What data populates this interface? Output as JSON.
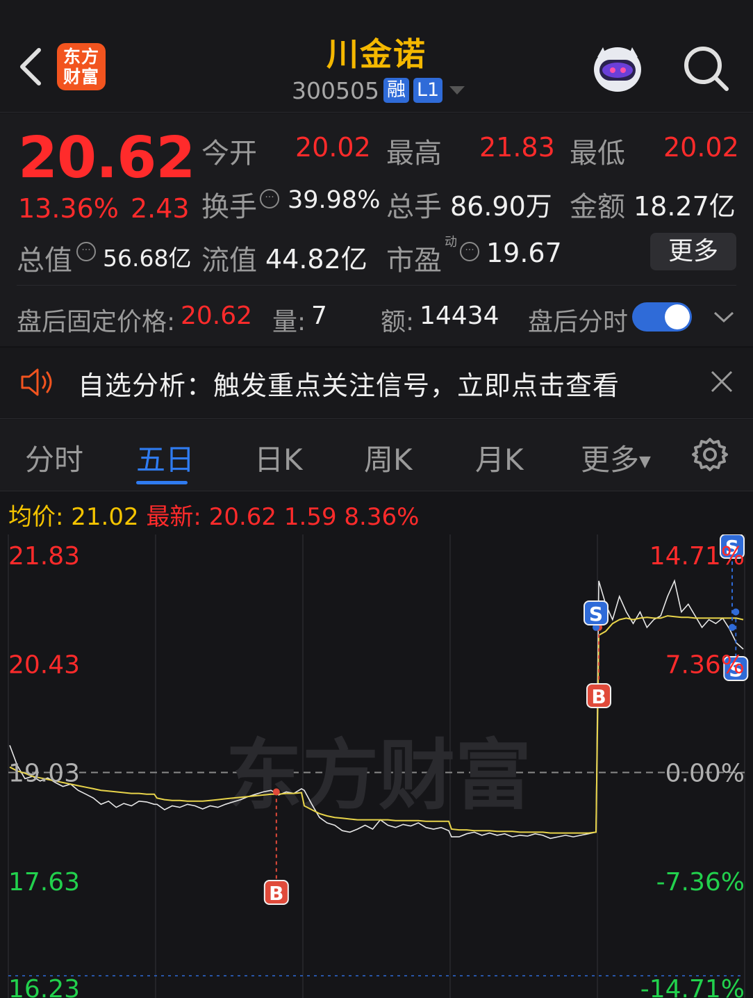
{
  "header": {
    "app_logo_text": [
      "东方",
      "财富"
    ],
    "stock_name": "川金诺",
    "stock_code": "300505",
    "tag_margin": "融",
    "tag_level": "L1"
  },
  "quote": {
    "price": "20.62",
    "change_pct": "13.36%",
    "change_amt": "2.43",
    "open_label": "今开",
    "open_value": "20.02",
    "high_label": "最高",
    "high_value": "21.83",
    "low_label": "最低",
    "low_value": "20.02",
    "turnover_label": "换手",
    "turnover_value": "39.98%",
    "volume_label": "总手",
    "volume_value": "86.90万",
    "amount_label": "金额",
    "amount_value": "18.27亿",
    "mktcap_label": "总值",
    "mktcap_value": "56.68亿",
    "float_label": "流值",
    "float_value": "44.82亿",
    "pe_label": "市盈",
    "pe_superscript": "动",
    "pe_value": "19.67",
    "more_button": "更多"
  },
  "after_hours": {
    "price_label": "盘后固定价格:",
    "price_value": "20.62",
    "qty_label": "量:",
    "qty_value": "7",
    "amount_label": "额:",
    "amount_value": "14434",
    "toggle_label": "盘后分时",
    "toggle_on": true
  },
  "alert": {
    "text": "自选分析：触发重点关注信号，立即点击查看"
  },
  "tabs": [
    "分时",
    "五日",
    "日K",
    "周K",
    "月K",
    "更多"
  ],
  "active_tab": 1,
  "chart_info": {
    "avg_label": "均价:",
    "avg_value": "21.02",
    "latest_label": "最新:",
    "latest_value": "20.62",
    "change": "1.59",
    "change_pct": "8.36%"
  },
  "watermark": "东方财富",
  "colors": {
    "up": "#ff2b2b",
    "down": "#22d14d",
    "accent": "#2f7bf0",
    "title": "#f5b800",
    "avg_line": "#e8d44a"
  },
  "chart_data": {
    "type": "line",
    "y_ticks_left": [
      "21.83",
      "20.43",
      "19.03",
      "17.63",
      "16.23"
    ],
    "y_ticks_right": [
      "14.71%",
      "7.36%",
      "0.00%",
      "-7.36%",
      "-14.71%"
    ],
    "ylim": [
      16.23,
      21.83
    ],
    "prev_close": 19.03,
    "days": 5,
    "series": [
      {
        "values": [
          19.38,
          19.12,
          18.95,
          18.98,
          18.92,
          18.96,
          18.9,
          18.85,
          18.88,
          18.8,
          18.75,
          18.7,
          18.62,
          18.66,
          18.58,
          18.63,
          18.6,
          18.66,
          18.65,
          18.62,
          18.62,
          18.55,
          18.6,
          18.58,
          18.62,
          18.6,
          18.56,
          18.6,
          18.58,
          18.62,
          18.65,
          18.68,
          18.72,
          18.75,
          18.78,
          18.8,
          18.74,
          18.78,
          18.76,
          18.82,
          18.8,
          18.62,
          18.45,
          18.38,
          18.35,
          18.28,
          18.26,
          18.3,
          18.35,
          18.3,
          18.42,
          18.35,
          18.32,
          18.36,
          18.34,
          18.38,
          18.32,
          18.3,
          18.32,
          18.28,
          18.2,
          18.2,
          18.24,
          18.26,
          18.22,
          18.25,
          18.22,
          18.24,
          18.2,
          18.22,
          18.21,
          18.24,
          18.22,
          18.18,
          18.2,
          18.22,
          18.2,
          18.22,
          18.24,
          18.26,
          21.5,
          21.2,
          21.0,
          21.3,
          21.1,
          20.95,
          21.1,
          20.9,
          21.0,
          21.05,
          21.3,
          21.5,
          21.1,
          21.2,
          21.05,
          20.9,
          21.0,
          20.95,
          21.02,
          20.88,
          20.7,
          20.62
        ]
      },
      {
        "values": [
          19.1,
          19.05,
          19.02,
          18.98,
          18.96,
          18.94,
          18.92,
          18.9,
          18.88,
          18.86,
          18.84,
          18.82,
          18.8,
          18.79,
          18.78,
          18.77,
          18.76,
          18.76,
          18.75,
          18.75,
          18.7,
          18.68,
          18.67,
          18.67,
          18.66,
          18.66,
          18.66,
          18.67,
          18.68,
          18.69,
          18.7,
          18.71,
          18.72,
          18.73,
          18.74,
          18.75,
          18.75,
          18.76,
          18.76,
          18.77,
          18.6,
          18.55,
          18.5,
          18.47,
          18.45,
          18.44,
          18.43,
          18.42,
          18.42,
          18.42,
          18.42,
          18.42,
          18.41,
          18.41,
          18.41,
          18.41,
          18.4,
          18.4,
          18.4,
          18.4,
          18.3,
          18.29,
          18.29,
          18.28,
          18.28,
          18.28,
          18.27,
          18.27,
          18.27,
          18.26,
          18.26,
          18.26,
          18.26,
          18.25,
          18.25,
          18.25,
          18.25,
          18.25,
          18.25,
          18.26,
          20.8,
          20.85,
          20.95,
          21.0,
          21.02,
          21.0,
          21.02,
          21.03,
          21.02,
          21.02,
          21.05,
          21.04,
          21.03,
          21.03,
          21.02,
          21.02,
          21.02,
          21.02,
          21.02,
          21.02,
          21.02,
          21.0
        ]
      }
    ],
    "markers": [
      {
        "label": "B",
        "day": 2
      },
      {
        "label": "B",
        "day": 5
      },
      {
        "label": "S",
        "day": 5
      },
      {
        "label": "S",
        "day": 5
      },
      {
        "label": "S",
        "day": 5
      }
    ]
  }
}
